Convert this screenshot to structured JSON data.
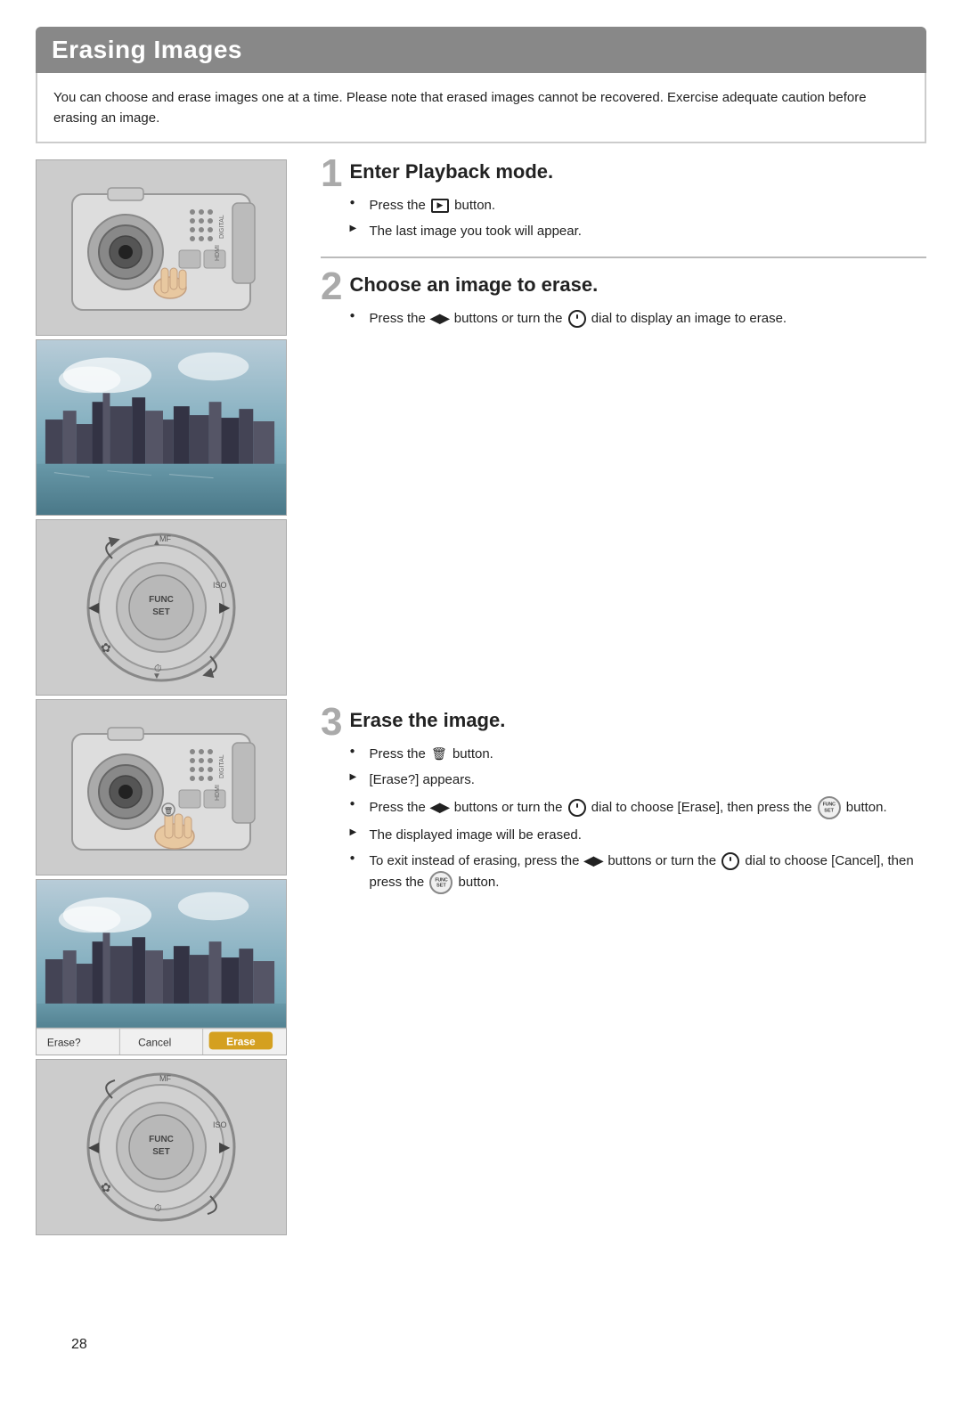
{
  "page": {
    "title": "Erasing Images",
    "intro": "You can choose and erase images one at a time. Please note that erased images cannot be recovered. Exercise adequate caution before erasing an image.",
    "page_number": "28"
  },
  "steps": [
    {
      "number": "1",
      "heading": "Enter Playback mode.",
      "bullets": [
        {
          "type": "circle",
          "text": "Press the [PLAYBACK] button."
        },
        {
          "type": "arrow",
          "text": "The last image you took will appear."
        }
      ]
    },
    {
      "number": "2",
      "heading": "Choose an image to erase.",
      "bullets": [
        {
          "type": "circle",
          "text": "Press the [LR] buttons or turn the [DIAL] dial to display an image to erase."
        }
      ]
    },
    {
      "number": "3",
      "heading": "Erase the image.",
      "bullets": [
        {
          "type": "circle",
          "text": "Press the [TRASH] button."
        },
        {
          "type": "arrow",
          "text": "[Erase?] appears."
        },
        {
          "type": "circle",
          "text": "Press the [LR] buttons or turn the [DIAL] dial to choose [Erase], then press the [FUNC] button."
        },
        {
          "type": "arrow",
          "text": "The displayed image will be erased."
        },
        {
          "type": "circle",
          "text": "To exit instead of erasing, press the [LR] buttons or turn the [DIAL] dial to choose [Cancel], then press the [FUNC] button."
        }
      ]
    }
  ],
  "erase_bar": {
    "label": "Erase?",
    "cancel": "Cancel",
    "erase": "Erase"
  }
}
